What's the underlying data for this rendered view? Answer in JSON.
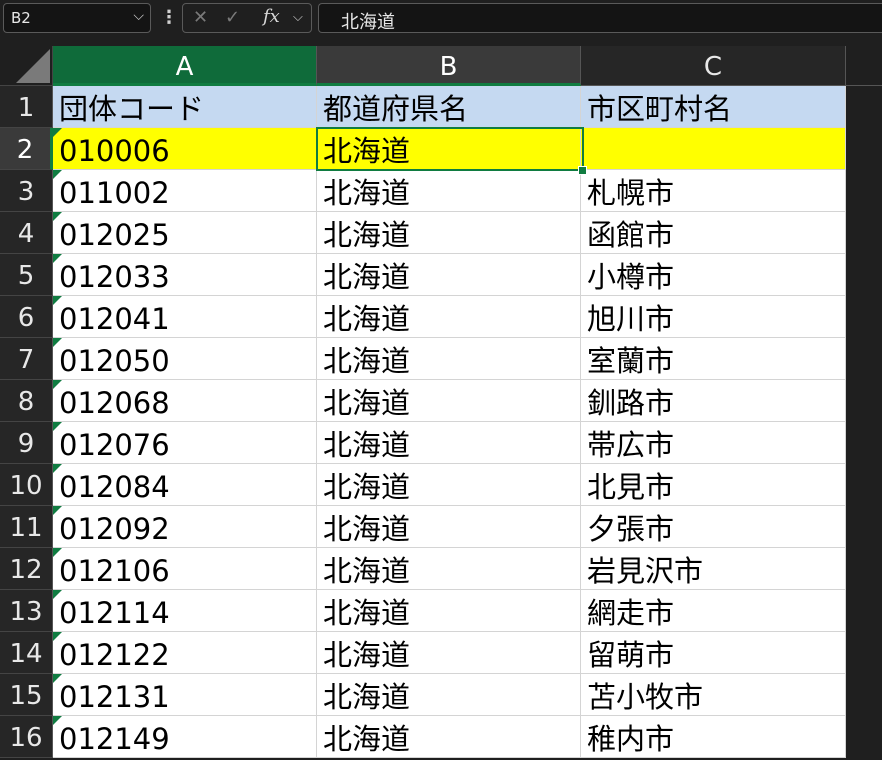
{
  "formula_bar": {
    "name_box": "B2",
    "name_box_chevron": "⌵",
    "separator": "⋮",
    "cancel_glyph": "✕",
    "enter_glyph": "✓",
    "fx_label": "fx",
    "fx_chevron": "⌵",
    "formula_value": "北海道"
  },
  "columns": [
    "A",
    "B",
    "C"
  ],
  "rows": [
    {
      "num": "1",
      "a": "団体コード",
      "b": "都道府県名",
      "c": "市区町村名"
    },
    {
      "num": "2",
      "a": "010006",
      "b": "北海道",
      "c": ""
    },
    {
      "num": "3",
      "a": "011002",
      "b": "北海道",
      "c": "札幌市"
    },
    {
      "num": "4",
      "a": "012025",
      "b": "北海道",
      "c": "函館市"
    },
    {
      "num": "5",
      "a": "012033",
      "b": "北海道",
      "c": "小樽市"
    },
    {
      "num": "6",
      "a": "012041",
      "b": "北海道",
      "c": "旭川市"
    },
    {
      "num": "7",
      "a": "012050",
      "b": "北海道",
      "c": "室蘭市"
    },
    {
      "num": "8",
      "a": "012068",
      "b": "北海道",
      "c": "釧路市"
    },
    {
      "num": "9",
      "a": "012076",
      "b": "北海道",
      "c": "帯広市"
    },
    {
      "num": "10",
      "a": "012084",
      "b": "北海道",
      "c": "北見市"
    },
    {
      "num": "11",
      "a": "012092",
      "b": "北海道",
      "c": "夕張市"
    },
    {
      "num": "12",
      "a": "012106",
      "b": "北海道",
      "c": "岩見沢市"
    },
    {
      "num": "13",
      "a": "012114",
      "b": "北海道",
      "c": "網走市"
    },
    {
      "num": "14",
      "a": "012122",
      "b": "北海道",
      "c": "留萌市"
    },
    {
      "num": "15",
      "a": "012131",
      "b": "北海道",
      "c": "苫小牧市"
    },
    {
      "num": "16",
      "a": "012149",
      "b": "北海道",
      "c": "稚内市"
    }
  ],
  "colors": {
    "header_row_fill": "#c5d9f1",
    "highlight_row_fill": "#ffff00",
    "selection_accent": "#107c41"
  },
  "active_cell": "B2"
}
